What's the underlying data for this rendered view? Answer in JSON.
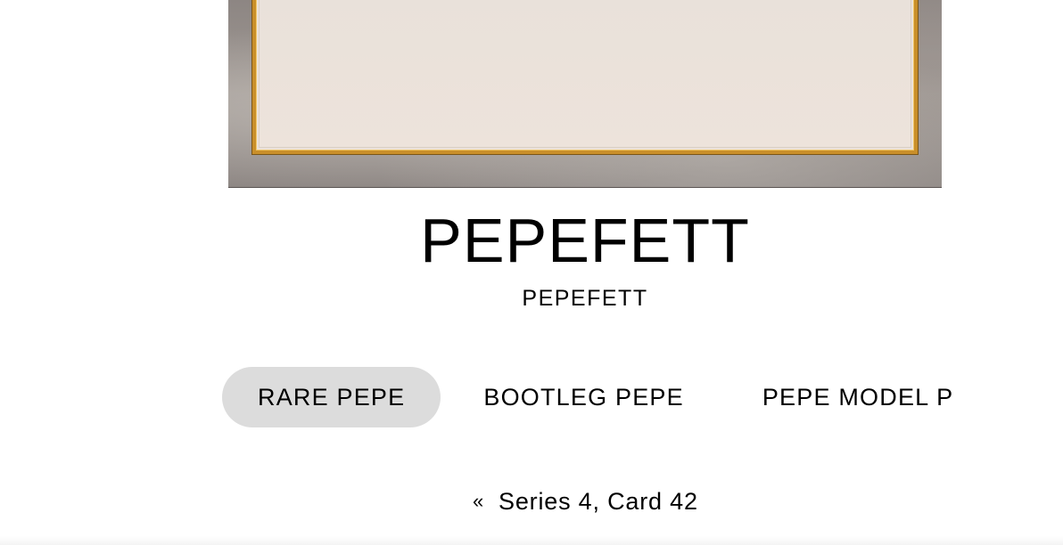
{
  "card": {
    "title": "PEPEFETT",
    "subtitle": "PEPEFETT"
  },
  "tabs": [
    {
      "label": "RARE PEPE",
      "active": true
    },
    {
      "label": "BOOTLEG PEPE",
      "active": false
    },
    {
      "label": "PEPE MODEL P",
      "active": false
    }
  ],
  "series_nav": {
    "prev_icon": "«",
    "label": "Series 4, Card 42"
  }
}
